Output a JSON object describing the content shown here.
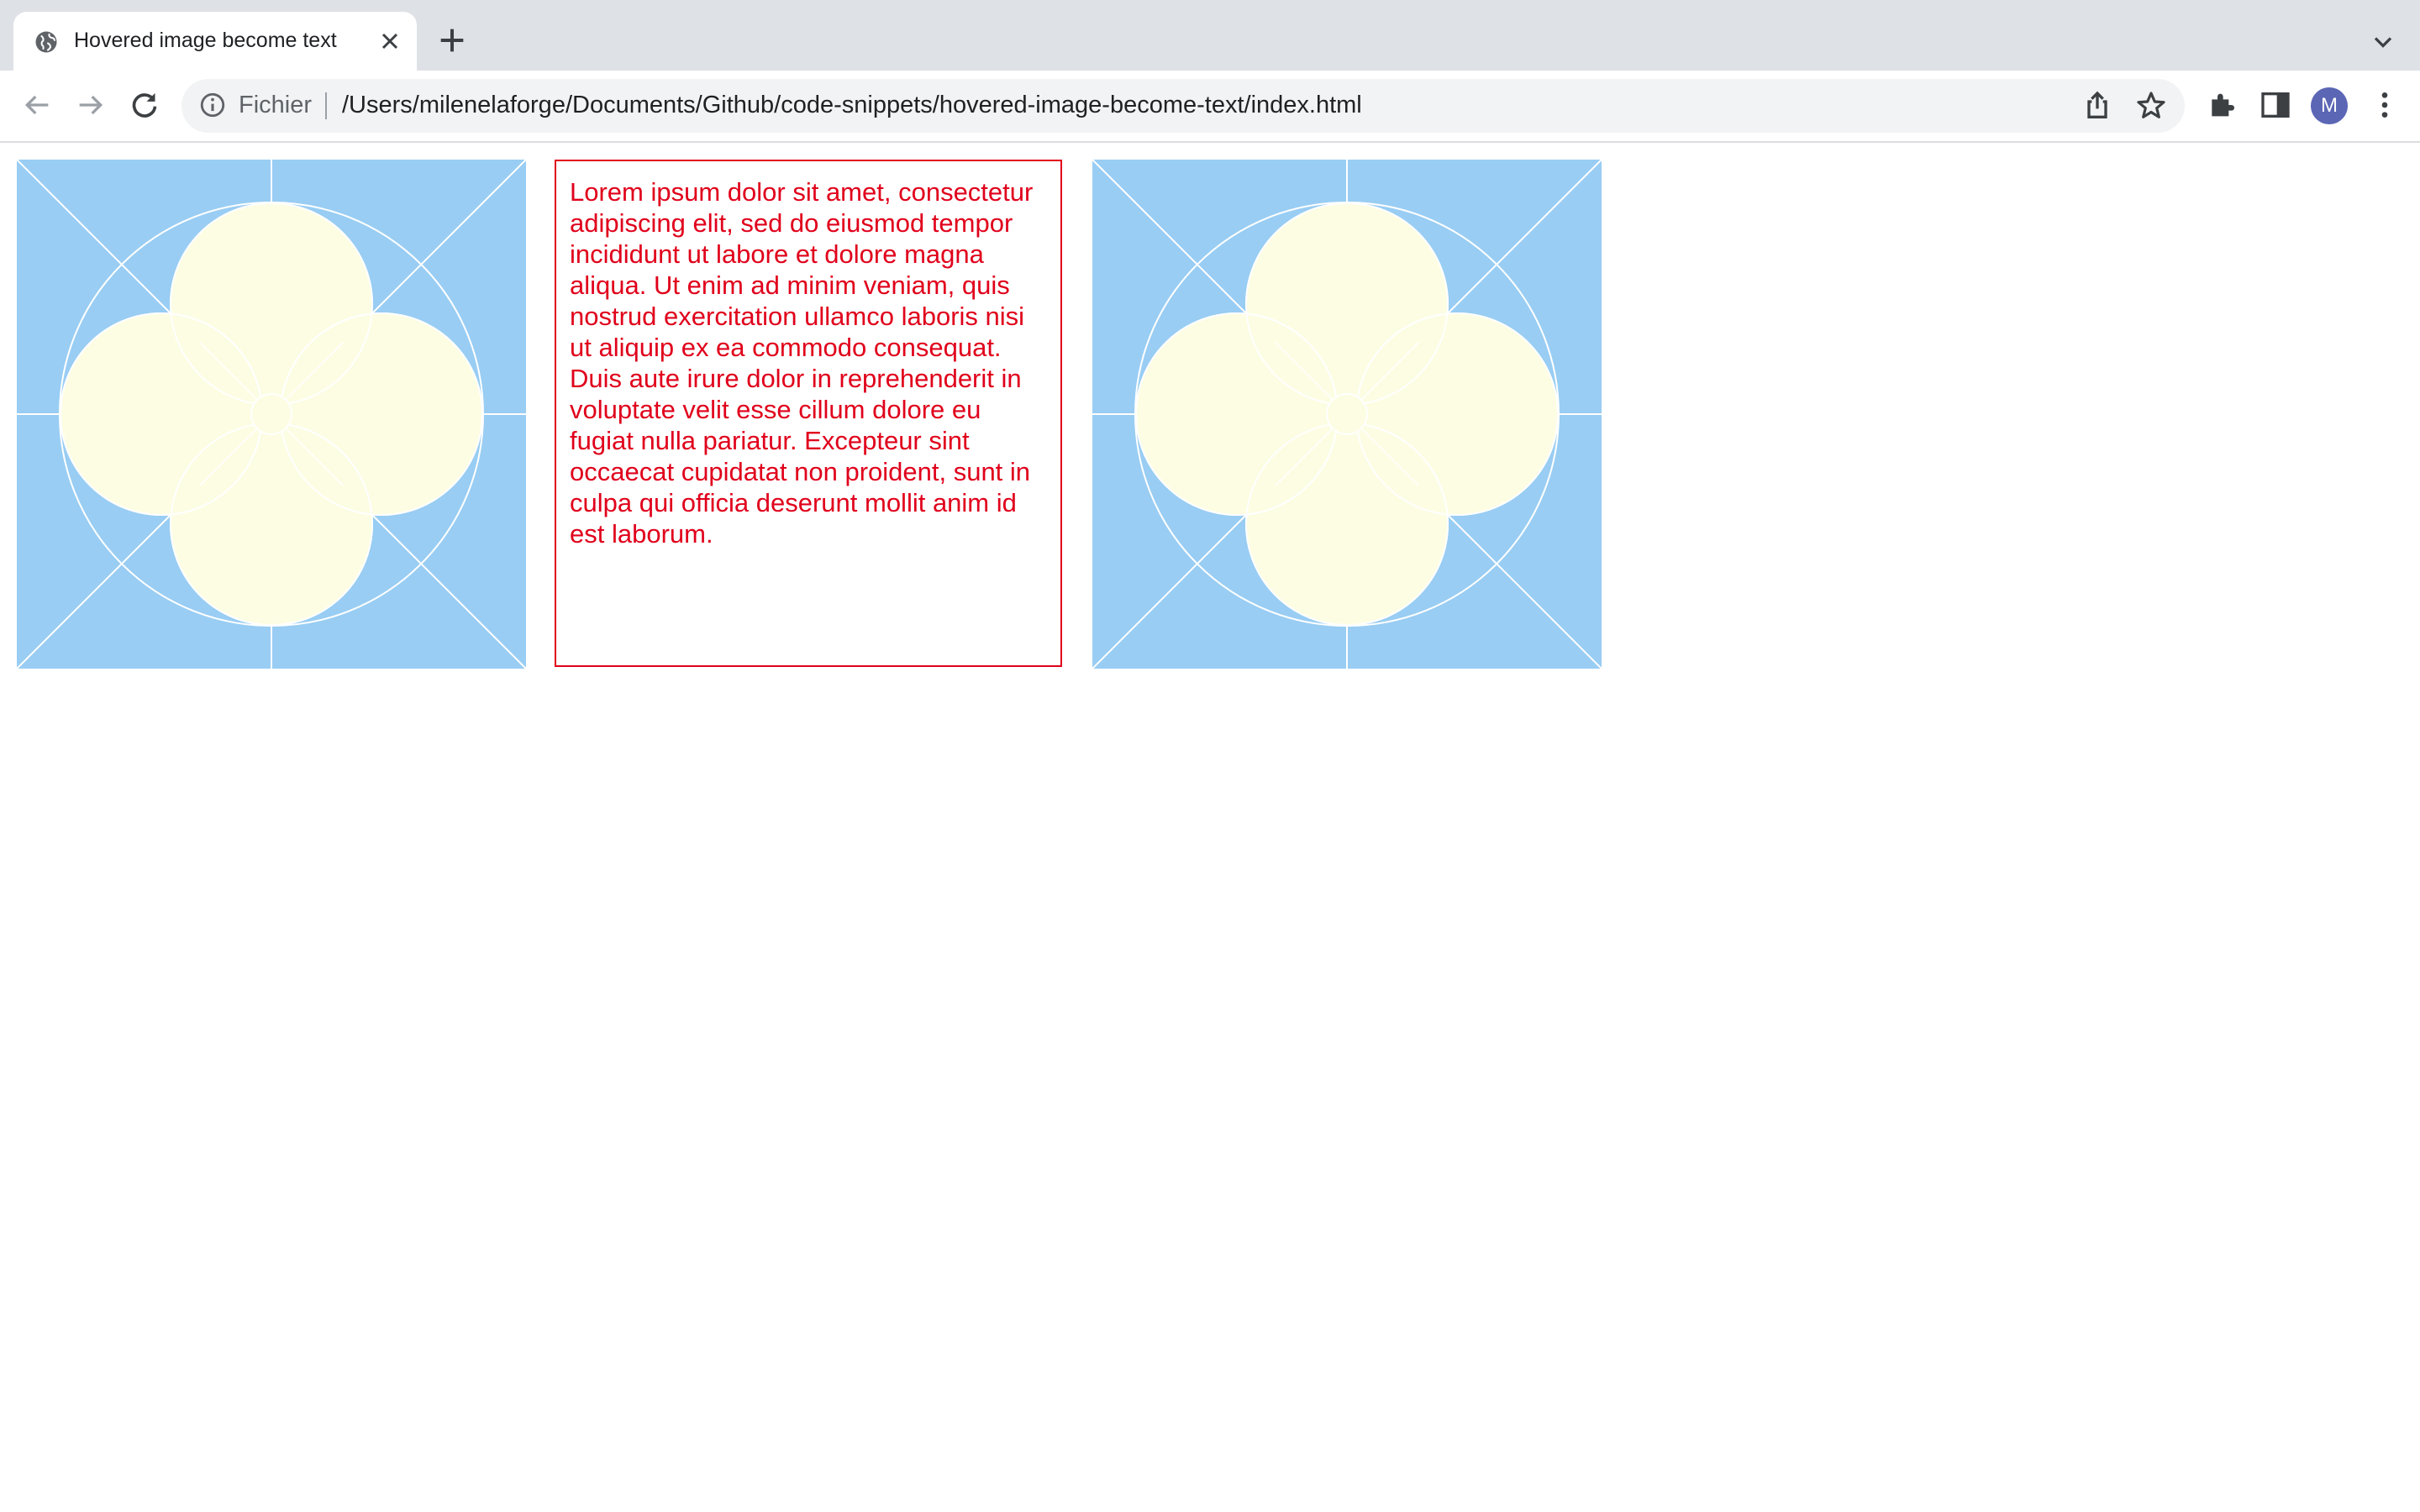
{
  "browser": {
    "tab": {
      "title": "Hovered image become text",
      "favicon": "globe-icon",
      "close_icon": "close-icon"
    },
    "new_tab_icon": "plus-icon",
    "tab_list_icon": "chevron-down-icon",
    "toolbar": {
      "back_icon": "arrow-left-icon",
      "forward_icon": "arrow-right-icon",
      "reload_icon": "reload-icon",
      "site_info_icon": "info-icon",
      "scheme_label": "Fichier",
      "url": "/Users/milenelaforge/Documents/Github/code-snippets/hovered-image-become-text/index.html",
      "share_icon": "share-icon",
      "bookmark_icon": "star-icon",
      "extensions_icon": "puzzle-icon",
      "side_panel_icon": "side-panel-icon",
      "profile_initial": "M",
      "menu_icon": "kebab-menu-icon"
    }
  },
  "page": {
    "tiles": [
      {
        "kind": "image",
        "icon": "quatrefoil-pattern"
      },
      {
        "kind": "text",
        "text": "Lorem ipsum dolor sit amet, consectetur adipiscing elit, sed do eiusmod tempor incididunt ut labore et dolore magna aliqua. Ut enim ad minim veniam, quis nostrud exercitation ullamco laboris nisi ut aliquip ex ea commodo consequat. Duis aute irure dolor in reprehenderit in voluptate velit esse cillum dolore eu fugiat nulla pariatur. Excepteur sint occaecat cupidatat non proident, sunt in culpa qui officia deserunt mollit anim id est laborum."
      },
      {
        "kind": "image",
        "icon": "quatrefoil-pattern"
      }
    ],
    "colors": {
      "tile_background": "#99cdf3",
      "petal_fill": "#fdfde3",
      "lines": "#ffffff",
      "text": "#e0001b"
    }
  }
}
